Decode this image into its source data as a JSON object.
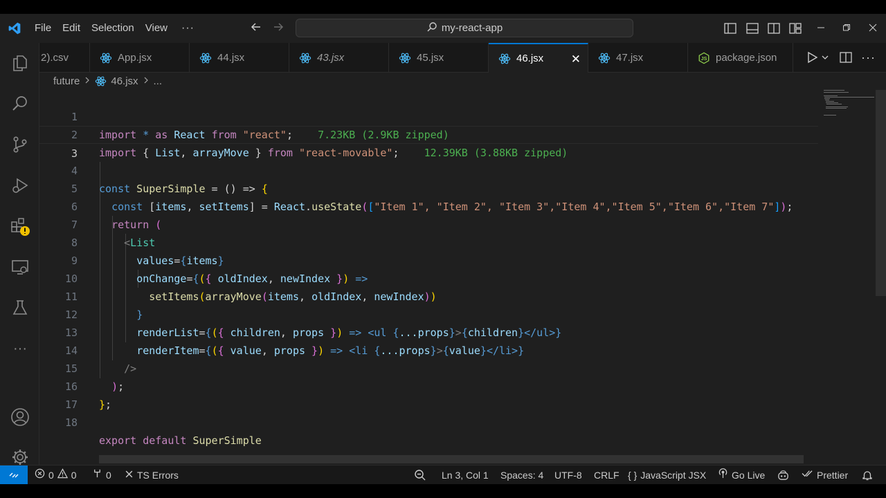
{
  "menu": [
    "File",
    "Edit",
    "Selection",
    "View"
  ],
  "menu_more": "···",
  "search": {
    "text": "my-react-app"
  },
  "tabs": [
    {
      "label": "2).csv",
      "italic": false,
      "icon": "csv-icon"
    },
    {
      "label": "App.jsx",
      "italic": false,
      "icon": "react-icon"
    },
    {
      "label": "44.jsx",
      "italic": false,
      "icon": "react-icon"
    },
    {
      "label": "43.jsx",
      "italic": true,
      "icon": "react-icon"
    },
    {
      "label": "45.jsx",
      "italic": false,
      "icon": "react-icon"
    },
    {
      "label": "46.jsx",
      "italic": false,
      "icon": "react-icon",
      "active": true
    },
    {
      "label": "47.jsx",
      "italic": false,
      "icon": "react-icon"
    },
    {
      "label": "package.json",
      "italic": false,
      "icon": "nodejs-icon"
    }
  ],
  "close_glyph": "✕",
  "breadcrumb": {
    "folder": "future",
    "file": "46.jsx",
    "more": "..."
  },
  "line_numbers": [
    "1",
    "2",
    "3",
    "4",
    "5",
    "6",
    "7",
    "8",
    "9",
    "10",
    "11",
    "12",
    "13",
    "14",
    "15",
    "16",
    "17",
    "18"
  ],
  "code": {
    "l1": {
      "import": "import",
      "star": " * ",
      "as": "as",
      "react": " React ",
      "from": "from",
      "str": " \"react\"",
      "semi": ";",
      "cost": "7.23KB (2.9KB zipped)"
    },
    "l2": {
      "import": "import",
      "ob": " { ",
      "list": "List",
      "comma": ", ",
      "arraymove": "arrayMove",
      "cb": " } ",
      "from": "from",
      "str": " \"react-movable\"",
      "semi": ";",
      "cost": "12.39KB (3.88KB zipped)"
    },
    "l4": {
      "const": "const",
      "name": " SuperSimple",
      "rest": " = () => ",
      "brace": "{"
    },
    "l5": {
      "const": "const",
      "ob": " [",
      "items": "items",
      "comma": ", ",
      "setitems": "setItems",
      "cb": "] = ",
      "react": "React",
      "dot": ".",
      "usestate": "useState",
      "p1": "(",
      "b1": "[",
      "strs": "\"Item 1\", \"Item 2\", \"Item 3\",\"Item 4\",\"Item 5\",\"Item 6\",\"Item 7\"",
      "b2": "]",
      "p2": ")",
      "semi": ";"
    },
    "l6": {
      "return": "return",
      "paren": " ("
    },
    "l7": {
      "lt": "<",
      "tag": "List"
    },
    "l8": {
      "attr": "values",
      "eq": "=",
      "ob": "{",
      "items": "items",
      "cb": "}"
    },
    "l9": {
      "attr": "onChange",
      "eq": "=",
      "ob": "{",
      "p": "(",
      "cb2": "{ ",
      "oldindex": "oldIndex",
      "comma": ", ",
      "newindex": "newIndex",
      "cb3": " }",
      "p2": ")",
      "arrow": " =>"
    },
    "l10": {
      "setitems": "setItems",
      "p": "(",
      "arraymove": "arrayMove",
      "p2": "(",
      "items": "items",
      "c1": ", ",
      "oldindex": "oldIndex",
      "c2": ", ",
      "newindex": "newIndex",
      "p3": ")",
      "p4": ")"
    },
    "l11": {
      "cb": "}"
    },
    "l12": {
      "attr": "renderList",
      "eq": "=",
      "ob": "{",
      "p": "(",
      "b": "{ ",
      "children": "children",
      "comma": ", ",
      "props": "props",
      "b2": " }",
      "p2": ")",
      "arrow": " => ",
      "open": "<ul ",
      "spread_ob": "{",
      "spread": "...props",
      "spread_cb": "}",
      "gt": ">",
      "c_ob": "{",
      "c": "children",
      "c_cb": "}",
      "close": "</ul>",
      "cb": "}"
    },
    "l13": {
      "attr": "renderItem",
      "eq": "=",
      "ob": "{",
      "p": "(",
      "b": "{ ",
      "value": "value",
      "comma": ", ",
      "props": "props",
      "b2": " }",
      "p2": ")",
      "arrow": " => ",
      "open": "<li ",
      "spread_ob": "{",
      "spread": "...props",
      "spread_cb": "}",
      "gt": ">",
      "c_ob": "{",
      "c": "value",
      "c_cb": "}",
      "close": "</li>",
      "cb": "}"
    },
    "l14": {
      "selfclose": "/>"
    },
    "l15": {
      "paren": ")",
      "semi": ";"
    },
    "l16": {
      "brace": "}",
      "semi": ";"
    },
    "l18": {
      "export": "export",
      "default": " default",
      "name": " SuperSimple"
    }
  },
  "status": {
    "errors": "0",
    "warnings": "0",
    "ports": "0",
    "ts_errors": "TS Errors",
    "position": "Ln 3, Col 1",
    "spaces": "Spaces: 4",
    "encoding": "UTF-8",
    "eol": "CRLF",
    "language_brace": "{ }",
    "language": "JavaScript JSX",
    "golive": "Go Live",
    "prettier": "Prettier"
  },
  "colors": {
    "accent": "#0078d4",
    "bg": "#1f1f1f",
    "react": "#4fc1ff",
    "cost": "#4caf50"
  }
}
